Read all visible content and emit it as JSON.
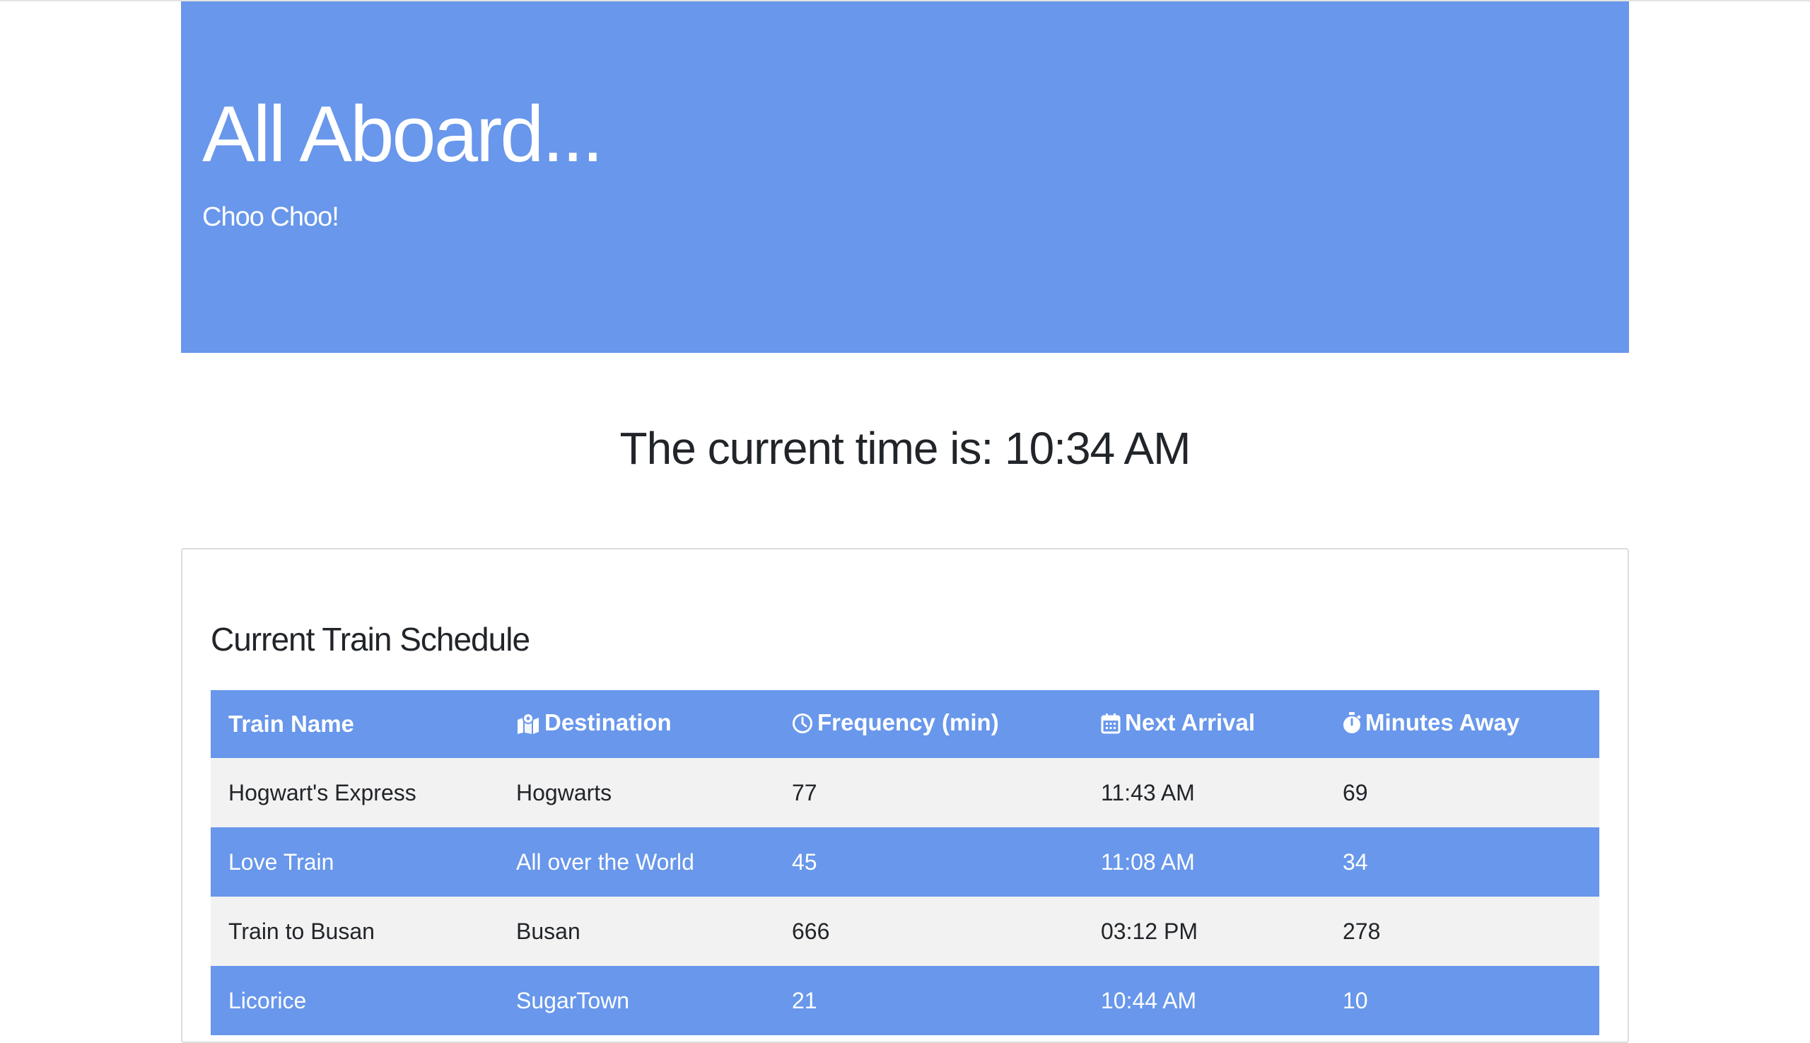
{
  "header": {
    "title": "All Aboard...",
    "subtitle": "Choo Choo!"
  },
  "current_time": {
    "label": "The current time is: 10:34 AM"
  },
  "schedule": {
    "title": "Current Train Schedule",
    "columns": [
      {
        "label": "Train Name",
        "icon": ""
      },
      {
        "label": "Destination",
        "icon": "map-marked-icon"
      },
      {
        "label": "Frequency (min)",
        "icon": "clock-icon"
      },
      {
        "label": "Next Arrival",
        "icon": "calendar-icon"
      },
      {
        "label": "Minutes Away",
        "icon": "stopwatch-icon"
      }
    ],
    "rows": [
      {
        "name": "Hogwart's Express",
        "destination": "Hogwarts",
        "frequency": "77",
        "next_arrival": "11:43 AM",
        "minutes_away": "69"
      },
      {
        "name": "Love Train",
        "destination": "All over the World",
        "frequency": "45",
        "next_arrival": "11:08 AM",
        "minutes_away": "34"
      },
      {
        "name": "Train to Busan",
        "destination": "Busan",
        "frequency": "666",
        "next_arrival": "03:12 PM",
        "minutes_away": "278"
      },
      {
        "name": "Licorice",
        "destination": "SugarTown",
        "frequency": "21",
        "next_arrival": "10:44 AM",
        "minutes_away": "10"
      }
    ]
  },
  "colors": {
    "accent": "#6897eb",
    "row_light": "#f2f2f2",
    "text": "#212529"
  }
}
